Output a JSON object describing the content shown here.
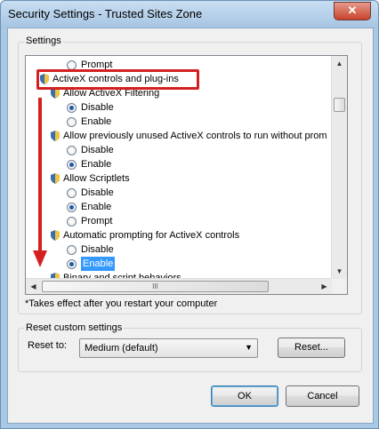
{
  "window": {
    "title": "Security Settings - Trusted Sites Zone",
    "close_glyph": "✕"
  },
  "settings": {
    "group_label": "Settings",
    "tree": [
      {
        "kind": "radio",
        "label": "Prompt",
        "checked": false
      },
      {
        "kind": "category",
        "label": "ActiveX controls and plug-ins"
      },
      {
        "kind": "setting",
        "label": "Allow ActiveX Filtering"
      },
      {
        "kind": "radio",
        "label": "Disable",
        "checked": true
      },
      {
        "kind": "radio",
        "label": "Enable",
        "checked": false
      },
      {
        "kind": "setting",
        "label": "Allow previously unused ActiveX controls to run without prom"
      },
      {
        "kind": "radio",
        "label": "Disable",
        "checked": false
      },
      {
        "kind": "radio",
        "label": "Enable",
        "checked": true
      },
      {
        "kind": "setting",
        "label": "Allow Scriptlets"
      },
      {
        "kind": "radio",
        "label": "Disable",
        "checked": false
      },
      {
        "kind": "radio",
        "label": "Enable",
        "checked": true
      },
      {
        "kind": "radio",
        "label": "Prompt",
        "checked": false
      },
      {
        "kind": "setting",
        "label": "Automatic prompting for ActiveX controls"
      },
      {
        "kind": "radio",
        "label": "Disable",
        "checked": false
      },
      {
        "kind": "radio",
        "label": "Enable",
        "checked": true,
        "selected": true
      },
      {
        "kind": "setting",
        "label": "Binary and script behaviors"
      }
    ],
    "hscroll_grip": "III",
    "footnote": "*Takes effect after you restart your computer"
  },
  "reset": {
    "group_label": "Reset custom settings",
    "reset_to_label": "Reset to:",
    "selected_option": "Medium (default)",
    "reset_button": "Reset..."
  },
  "buttons": {
    "ok": "OK",
    "cancel": "Cancel"
  },
  "colors": {
    "annotation": "#d42020",
    "selection": "#3399ff",
    "title_bg": "#a9c8e6"
  }
}
